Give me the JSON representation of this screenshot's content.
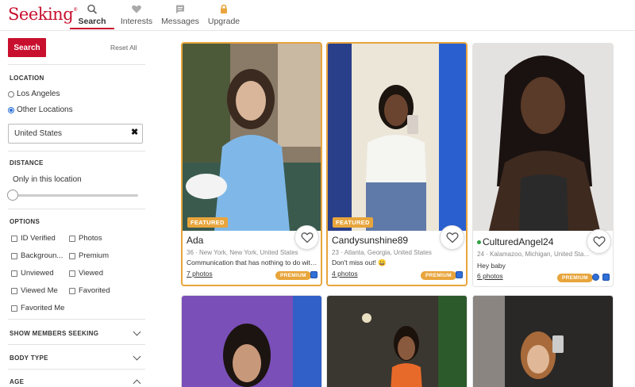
{
  "brand": {
    "logo": "Seeking",
    "accent": "#c8102e"
  },
  "nav": [
    {
      "label": "Search",
      "icon": "search-icon",
      "active": true
    },
    {
      "label": "Interests",
      "icon": "heart-icon"
    },
    {
      "label": "Messages",
      "icon": "message-icon"
    },
    {
      "label": "Upgrade",
      "icon": "lock-icon"
    }
  ],
  "sidebar": {
    "search_label": "Search",
    "reset_label": "Reset All",
    "location": {
      "title": "LOCATION",
      "options": [
        "Los Angeles",
        "Other Locations"
      ],
      "selected": "Other Locations",
      "input_value": "United States"
    },
    "distance": {
      "title": "DISTANCE",
      "label": "Only in this location",
      "slider_value": 0
    },
    "options": {
      "title": "OPTIONS",
      "items": [
        "ID Verified",
        "Photos",
        "Backgroun...",
        "Premium",
        "Unviewed",
        "Viewed",
        "Viewed Me",
        "Favorited",
        "Favorited Me"
      ]
    },
    "collapsed": [
      {
        "label": "SHOW MEMBERS SEEKING",
        "expanded": false
      },
      {
        "label": "BODY TYPE",
        "expanded": false
      },
      {
        "label": "AGE",
        "expanded": true
      }
    ]
  },
  "cards": [
    {
      "featured": true,
      "featured_label": "FEATURED",
      "name": "Ada",
      "online": false,
      "meta": "36 · New York, New York, United States",
      "desc": "Communication that has nothing to do with …",
      "photos": "7 photos",
      "premium": "PREMIUM"
    },
    {
      "featured": true,
      "featured_label": "FEATURED",
      "name": "Candysunshine89",
      "online": false,
      "meta": "23 · Atlanta, Georgia, United States",
      "desc": "Don't miss out! 😀",
      "photos": "4 photos",
      "premium": "PREMIUM"
    },
    {
      "featured": false,
      "name": "CulturedAngel24",
      "online": true,
      "meta": "24 · Kalamazoo, Michigan, United Sta…",
      "desc": "Hey baby",
      "photos": "6 photos",
      "premium": "PREMIUM"
    }
  ]
}
